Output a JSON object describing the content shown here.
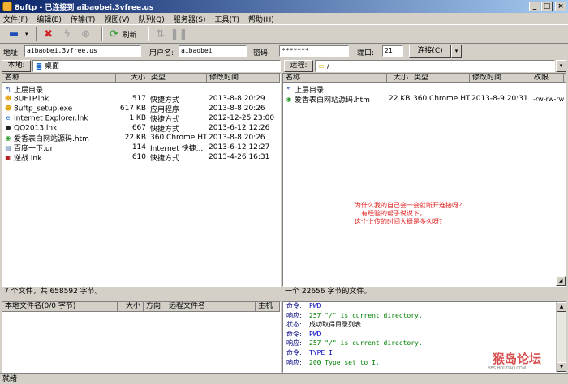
{
  "window": {
    "title": "8uftp - 已连接到 aibaobei.3vfree.us"
  },
  "menu": [
    "文件(F)",
    "编辑(E)",
    "传输(T)",
    "视图(V)",
    "队列(Q)",
    "服务器(S)",
    "工具(T)",
    "帮助(H)"
  ],
  "toolbar": {
    "refresh": "刷新"
  },
  "connect": {
    "host_label": "地址:",
    "host": "aibaobei.3vfree.us",
    "user_label": "用户名:",
    "user": "aibaobei",
    "pass_label": "密码:",
    "pass": "*******",
    "port_label": "端口:",
    "port": "21",
    "connect_btn": "连接(C)"
  },
  "local": {
    "label": "本地:",
    "path": "桌面",
    "columns": [
      "名称",
      "大小",
      "类型",
      "修改时间"
    ],
    "files": [
      {
        "name": "上层目录",
        "size": "",
        "type": "",
        "date": "",
        "icon": "up-folder-icon",
        "glyph": "↰",
        "color": "#1f4fb8"
      },
      {
        "name": "8UFTP.lnk",
        "size": "517",
        "type": "快捷方式",
        "date": "2013-8-8 20:29",
        "icon": "8uftp-icon",
        "glyph": "☻",
        "color": "#e0a000"
      },
      {
        "name": "8uftp_setup.exe",
        "size": "617 KB",
        "type": "应用程序",
        "date": "2013-8-8 20:26",
        "icon": "8uftp-icon",
        "glyph": "☻",
        "color": "#e0a000"
      },
      {
        "name": "Internet  Explorer.lnk",
        "size": "1 KB",
        "type": "快捷方式",
        "date": "2012-12-25 23:00",
        "icon": "ie-icon",
        "glyph": "e",
        "color": "#1f6fd0"
      },
      {
        "name": "QQ2013.lnk",
        "size": "667",
        "type": "快捷方式",
        "date": "2013-6-12 12:26",
        "icon": "qq-icon",
        "glyph": "●",
        "color": "#222222"
      },
      {
        "name": "爱香表白网站源码.htm",
        "size": "22 KB",
        "type": "360 Chrome HT...",
        "date": "2013-8-8 20:26",
        "icon": "chrome-icon",
        "glyph": "◉",
        "color": "#2d9a2d"
      },
      {
        "name": "百度一下.url",
        "size": "114",
        "type": "Internet 快捷...",
        "date": "2013-6-12 12:27",
        "icon": "url-icon",
        "glyph": "▤",
        "color": "#5a7ab0"
      },
      {
        "name": "逆战.lnk",
        "size": "610",
        "type": "快捷方式",
        "date": "2013-4-26 16:31",
        "icon": "game-icon",
        "glyph": "▣",
        "color": "#b02020"
      }
    ],
    "status": "7 个文件，共 658592 字节。"
  },
  "remote": {
    "label": "远程:",
    "path": "/",
    "columns": [
      "名称",
      "大小",
      "类型",
      "修改时间",
      "权限"
    ],
    "files": [
      {
        "name": "上层目录",
        "size": "",
        "type": "",
        "date": "",
        "perm": "",
        "icon": "up-folder-icon",
        "glyph": "↰",
        "color": "#1f4fb8"
      },
      {
        "name": "爱香表白网站源码.htm",
        "size": "22 KB",
        "type": "360 Chrome HT...",
        "date": "2013-8-9 20:31",
        "perm": "-rw-rw-rw-",
        "icon": "chrome-icon",
        "glyph": "◉",
        "color": "#2d9a2d"
      }
    ],
    "note": [
      "为什么我的自己会一会就断开连接呀？",
      "有经验的帮子说说下，",
      "这个上传的时间大概是多久呀？"
    ],
    "status": "一个 22656 字节的文件。"
  },
  "queue": {
    "columns": [
      "本地文件名(0/0 字节)",
      "大小",
      "方向",
      "远程文件名",
      "主机"
    ]
  },
  "log": [
    {
      "k": "命令:",
      "v": "PWD",
      "color": "#0000c0"
    },
    {
      "k": "响应:",
      "v": "257 \"/\" is current directory.",
      "color": "#008000"
    },
    {
      "k": "状态:",
      "v": "成功取得目录列表",
      "color": "#000000"
    },
    {
      "k": "命令:",
      "v": "PWD",
      "color": "#0000c0"
    },
    {
      "k": "响应:",
      "v": "257 \"/\" is current directory.",
      "color": "#008000"
    },
    {
      "k": "命令:",
      "v": "TYPE I",
      "color": "#0000c0"
    },
    {
      "k": "响应:",
      "v": "200 Type set to I.",
      "color": "#008000"
    }
  ],
  "statusbar": {
    "text": "就绪"
  },
  "watermark": {
    "text": "猴岛论坛",
    "sub": "BBS.HOUDAO.COM"
  }
}
